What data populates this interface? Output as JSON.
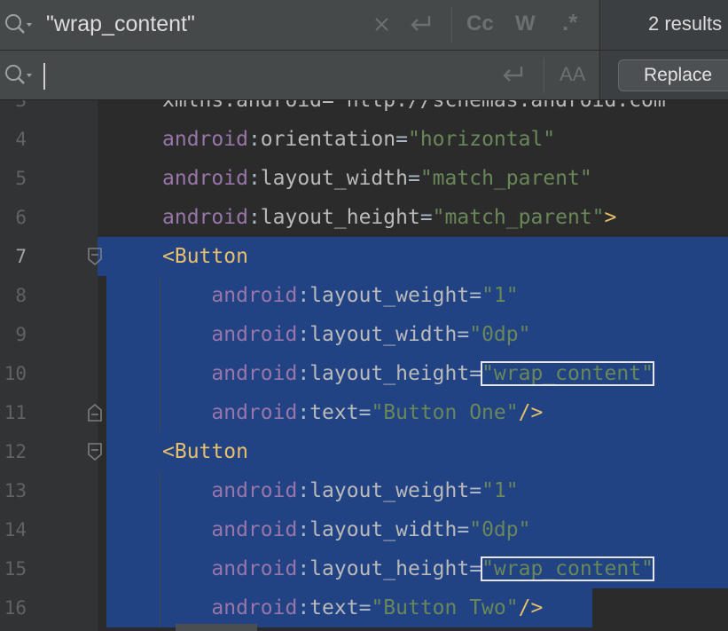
{
  "find": {
    "query": "\"wrap_content\"",
    "icons": [
      "search-history-icon",
      "clear-icon",
      "new-line-icon"
    ],
    "match_case_label": "Cc",
    "words_label": "W",
    "regex_label": ".*",
    "results": "2 results"
  },
  "replace": {
    "value": "",
    "icons": [
      "search-history-icon",
      "new-line-icon",
      "preserve-case-icon"
    ],
    "preserve_case_label": "AA",
    "button_label": "Replace"
  },
  "colors": {
    "selection": "#214283",
    "namespace": "#9876aa",
    "attribute": "#bababa",
    "string": "#6a8759",
    "tag": "#e8bf6a",
    "punctuation": "#a9b7c6"
  },
  "editor": {
    "current_line": "7",
    "lines": [
      {
        "num": "3",
        "partial": "xmlns:android=\"http://schemas.android.com"
      },
      {
        "num": "4",
        "ns": "android",
        "attr": "orientation",
        "val": "\"horizontal\""
      },
      {
        "num": "5",
        "ns": "android",
        "attr": "layout_width",
        "val": "\"match_parent\""
      },
      {
        "num": "6",
        "ns": "android",
        "attr": "layout_height",
        "val": "\"match_parent\"",
        "close": ">"
      },
      {
        "num": "7",
        "tag": "<Button"
      },
      {
        "num": "8",
        "ns": "android",
        "attr": "layout_weight",
        "val": "\"1\""
      },
      {
        "num": "9",
        "ns": "android",
        "attr": "layout_width",
        "val": "\"0dp\""
      },
      {
        "num": "10",
        "ns": "android",
        "attr": "layout_height",
        "val": "\"wrap_content\""
      },
      {
        "num": "11",
        "ns": "android",
        "attr": "text",
        "val": "\"Button One\"",
        "close": "/>"
      },
      {
        "num": "12",
        "tag": "<Button"
      },
      {
        "num": "13",
        "ns": "android",
        "attr": "layout_weight",
        "val": "\"1\""
      },
      {
        "num": "14",
        "ns": "android",
        "attr": "layout_width",
        "val": "\"0dp\""
      },
      {
        "num": "15",
        "ns": "android",
        "attr": "layout_height",
        "val": "\"wrap_content\""
      },
      {
        "num": "16",
        "ns": "android",
        "attr": "text",
        "val": "\"Button Two\"",
        "close": "/>"
      }
    ]
  }
}
